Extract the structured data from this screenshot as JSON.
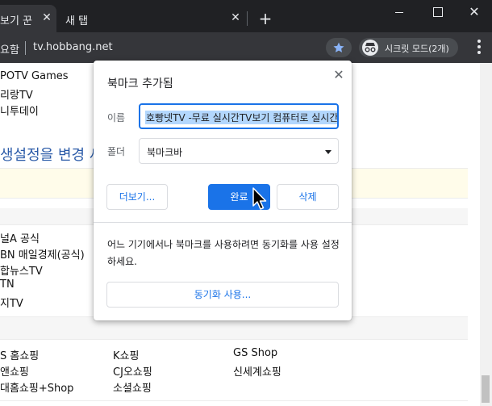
{
  "tabs": [
    {
      "title": "보기 꾼",
      "close": "✕"
    },
    {
      "title": "새 탭",
      "close": "✕"
    }
  ],
  "new_tab": "+",
  "window": {
    "close": "✕"
  },
  "toolbar": {
    "security_text": "요함",
    "url": "tv.hobbang.net",
    "incognito_label": "시크릿 모드(2개)"
  },
  "page": {
    "channels_top": [
      "POTV Games",
      "리랑TV",
      "니투데이"
    ],
    "banner": "생설정을 변경                                                           세요",
    "channels_news": [
      "널A 공식",
      "BN 매일경제(공식)",
      "합뉴스TV",
      "TN",
      "지TV"
    ],
    "shopping": [
      [
        "S 홈쇼핑",
        "K쇼핑",
        "GS Shop"
      ],
      [
        "앤쇼핑",
        "CJ오쇼핑",
        "신세계쇼핑"
      ],
      [
        "대홈쇼핑+Shop",
        "소셜쇼핑",
        ""
      ]
    ]
  },
  "dialog": {
    "title": "북마크 추가됨",
    "close": "✕",
    "name_label": "이름",
    "name_value": "호빵넷TV -무료 실시간TV보기 컴퓨터로 실시간",
    "folder_label": "폴더",
    "folder_value": "북마크바",
    "more_button": "더보기...",
    "done_button": "완료",
    "delete_button": "삭제",
    "sync_text": "어느 기기에서나 북마크를 사용하려면 동기화를 사용 설정하세요.",
    "sync_button": "동기화 사용..."
  },
  "colors": {
    "accent": "#1a73e8",
    "chrome_dark": "#202124",
    "toolbar": "#35363a",
    "link_blue": "#2b5ba8"
  },
  "icons": [
    "bookmark-star-icon",
    "incognito-icon",
    "menu-dots-icon",
    "mouse-cursor-icon"
  ]
}
